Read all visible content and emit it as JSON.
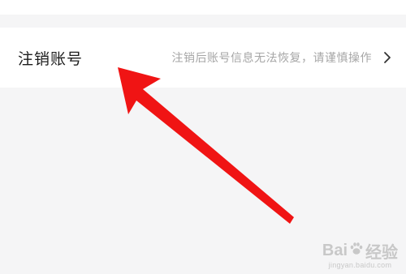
{
  "settings_row": {
    "title": "注销账号",
    "description": "注销后账号信息无法恢复，请谨慎操作"
  },
  "icons": {
    "chevron": "chevron-right-icon",
    "annotation": "red-arrow-annotation"
  },
  "colors": {
    "background": "#f5f5f6",
    "row_background": "#ffffff",
    "title_text": "#1c1c1c",
    "description_text": "#a6a6a6",
    "annotation_arrow": "#f01414"
  },
  "watermark": {
    "brand_prefix": "Bai",
    "brand_suffix": "经验",
    "url": "jingyan.baidu.com"
  }
}
